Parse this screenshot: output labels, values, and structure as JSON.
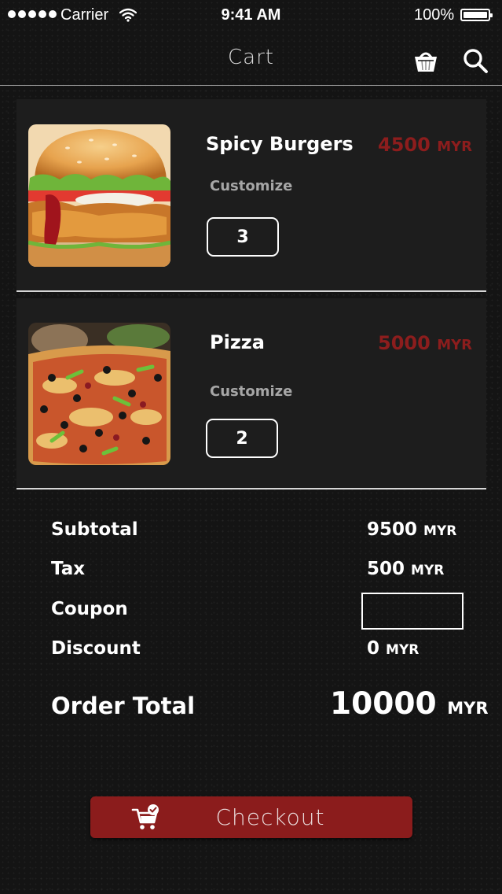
{
  "status_bar": {
    "carrier": "Carrier",
    "time": "9:41 AM",
    "battery": "100%"
  },
  "nav": {
    "title": "Cart",
    "icons": [
      "basket-icon",
      "search-icon"
    ]
  },
  "cart_items": [
    {
      "name": "Spicy Burgers",
      "price": "4500",
      "currency": "MYR",
      "customize_label": "Customize",
      "quantity": "3",
      "image": "burger-image"
    },
    {
      "name": "Pizza",
      "price": "5000",
      "currency": "MYR",
      "customize_label": "Customize",
      "quantity": "2",
      "image": "pizza-image"
    }
  ],
  "summary": {
    "subtotal_label": "Subtotal",
    "subtotal_value": "9500",
    "tax_label": "Tax",
    "tax_value": "500",
    "coupon_label": "Coupon",
    "coupon_value": "",
    "discount_label": "Discount",
    "discount_value": "0",
    "currency": "MYR",
    "total_label": "Order Total",
    "total_value": "10000"
  },
  "checkout": {
    "label": "Checkout",
    "icon": "cart-check-icon"
  },
  "colors": {
    "accent": "#8b1c1c",
    "price": "#8c1d1d",
    "background": "#141414",
    "card": "#1d1d1d"
  }
}
